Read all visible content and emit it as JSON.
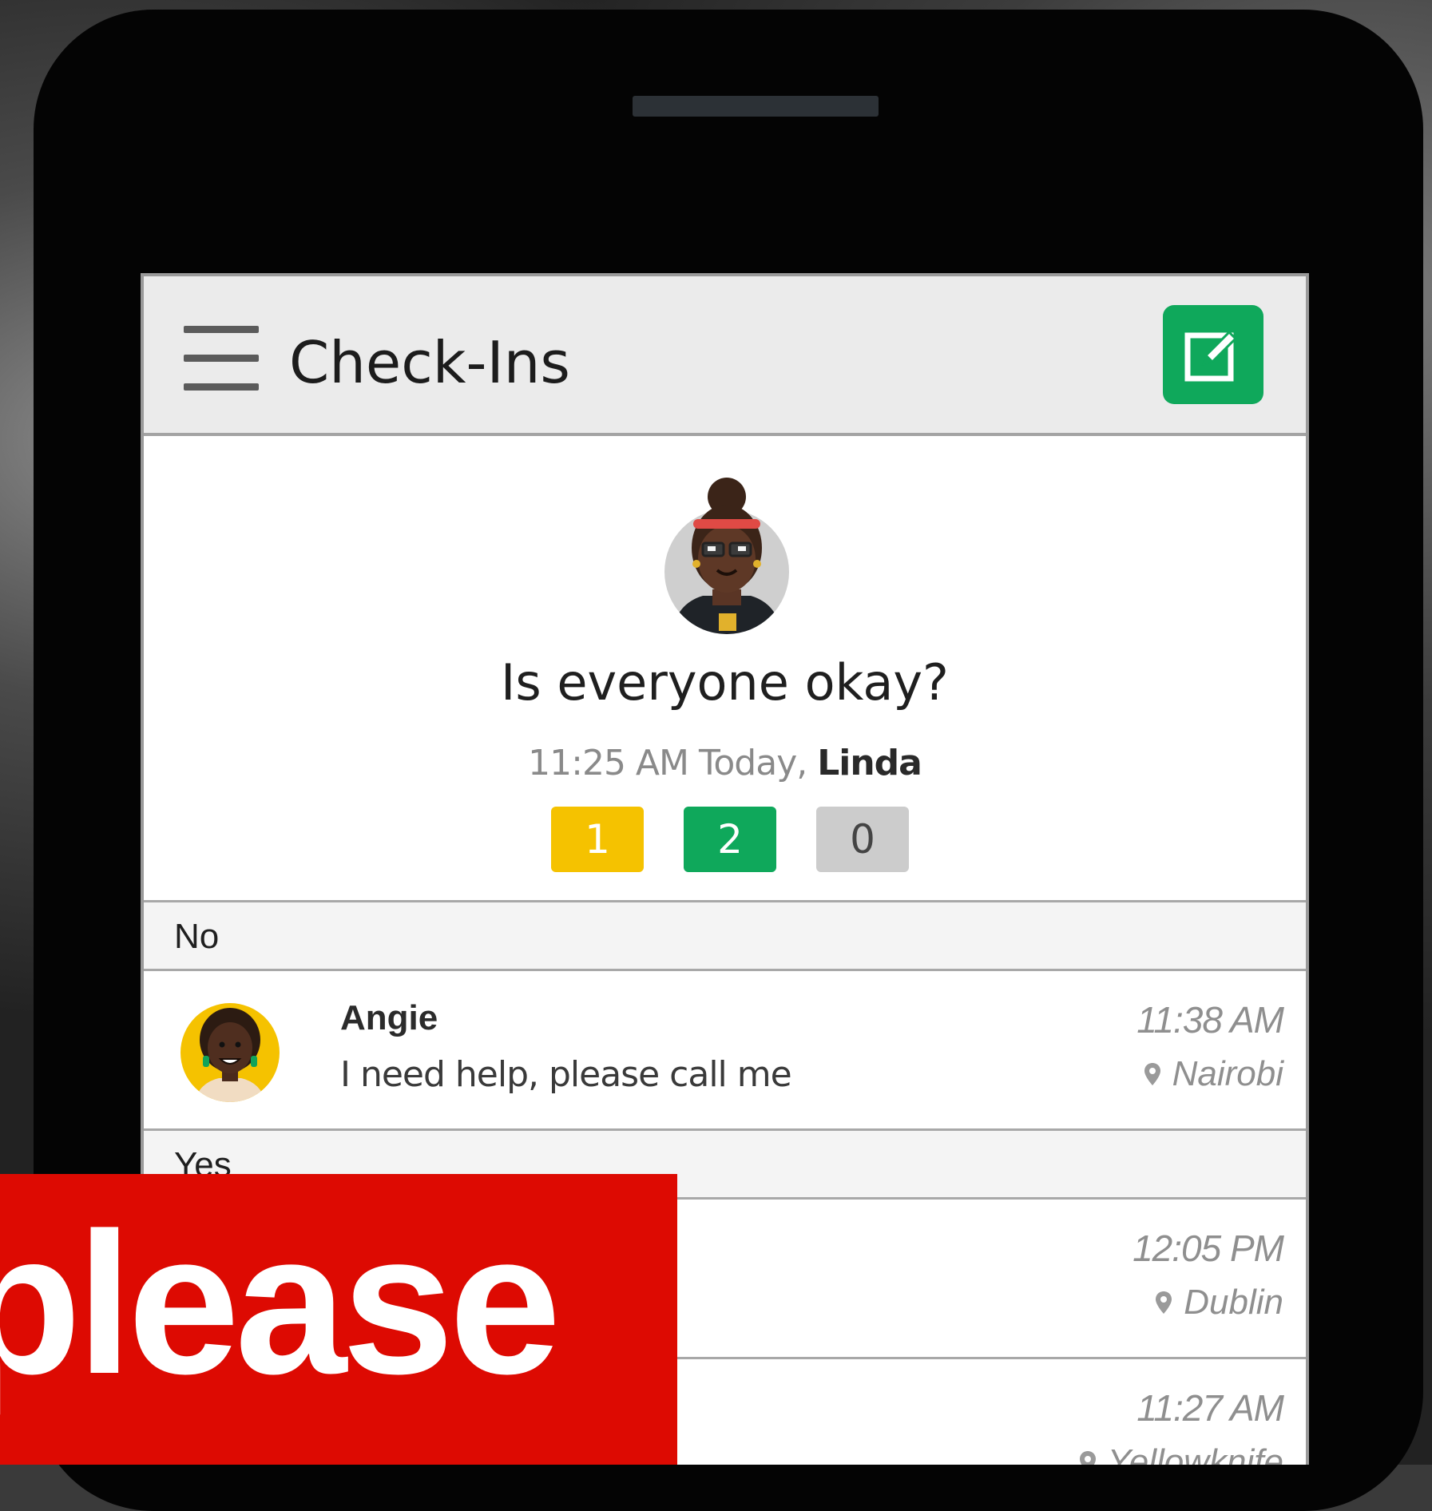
{
  "header": {
    "title": "Check-Ins",
    "menu_icon": "hamburger-icon",
    "compose_icon": "edit-icon"
  },
  "checkin": {
    "question": "Is everyone okay?",
    "time": "11:25 AM Today,",
    "author": "Linda",
    "counts": [
      {
        "label": "1",
        "color": "#f5c200"
      },
      {
        "label": "2",
        "color": "#0fa85b"
      },
      {
        "label": "0",
        "color": "#cccccc"
      }
    ]
  },
  "sections": {
    "no": {
      "label": "No",
      "items": [
        {
          "name": "Angie",
          "message": "I need help, please call me",
          "time": "11:38 AM",
          "location": "Nairobi"
        }
      ]
    },
    "yes": {
      "label": "Yes",
      "items": [
        {
          "time": "12:05 PM",
          "location": "Dublin"
        },
        {
          "time": "11:27 AM",
          "location": "Yellowknife"
        }
      ]
    }
  },
  "banner": {
    "text": "please"
  },
  "colors": {
    "accent_green": "#0fa85b",
    "warning_yellow": "#f5c200",
    "banner_red": "#dd0a02"
  }
}
